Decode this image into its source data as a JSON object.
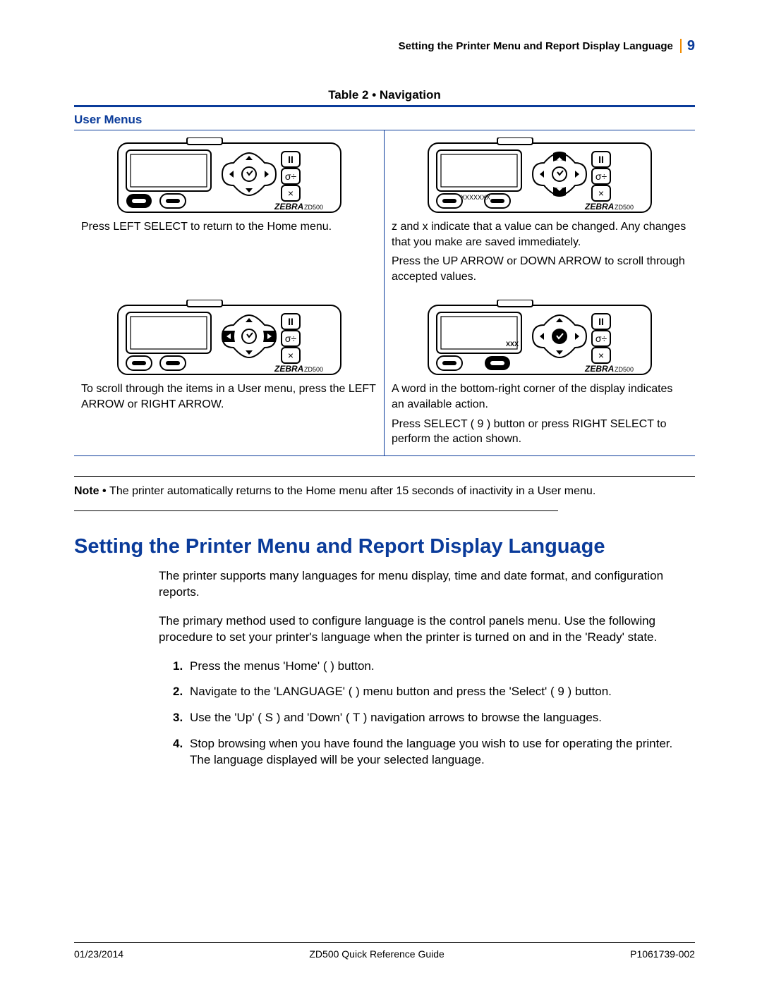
{
  "header": {
    "title": "Setting the Printer Menu and Report Display Language",
    "page_number": "9"
  },
  "table": {
    "title": "Table 2 • Navigation",
    "section_label": "User Menus",
    "cells": {
      "a1": "Press LEFT SELECT to return to the Home menu.",
      "a2_p1": "z and x indicate that a value can be changed. Any changes that you make are saved immediately.",
      "a2_p2": "Press the UP ARROW or DOWN ARROW to scroll through accepted values.",
      "b1": "To scroll through the items in a User menu, press the LEFT ARROW or RIGHT ARROW.",
      "b2_p1": "A word in the bottom-right corner of the display indicates an available action.",
      "b2_p2": "Press SELECT ( 9 ) button or press RIGHT SELECT to perform the action shown."
    },
    "printer_label_xs": "XXXXXXX",
    "printer_label_xxx": "XXX",
    "brand": "ZEBRA",
    "model": "ZD500"
  },
  "note": {
    "prefix": "Note • ",
    "text": "The printer automatically returns to the Home menu after 15 seconds of inactivity in a User menu."
  },
  "section": {
    "heading": "Setting the Printer Menu and Report Display Language",
    "p1": "The printer supports many languages for menu display, time and date format, and configuration reports.",
    "p2": "The primary method used to configure language is the control panels menu. Use the following procedure to set your printer's language when the printer is turned on and in the 'Ready' state.",
    "steps": {
      "s1": "Press the menus 'Home' (      ) button.",
      "s2": "Navigate to the 'LANGUAGE' (     ) menu button and press the 'Select' ( 9 ) button.",
      "s3": "Use the 'Up' ( S ) and 'Down' ( T ) navigation arrows to browse the languages.",
      "s4": "Stop browsing when you have found the language you wish to use for operating the printer. The language displayed will be your selected language."
    }
  },
  "footer": {
    "date": "01/23/2014",
    "doc": "ZD500 Quick Reference Guide",
    "part": "P1061739-002"
  }
}
